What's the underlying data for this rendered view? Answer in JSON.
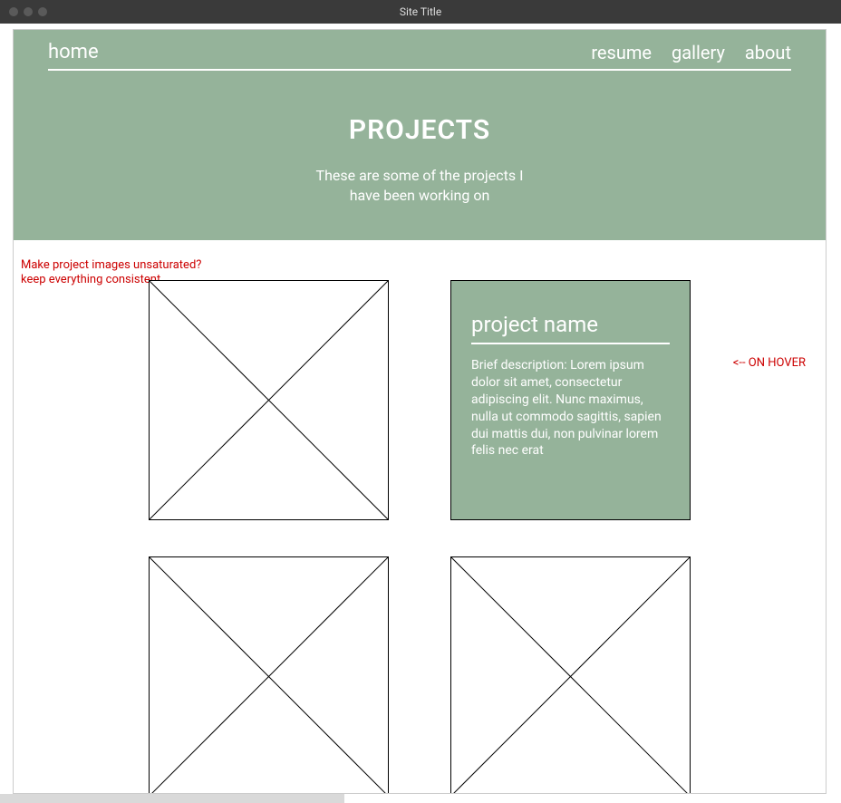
{
  "window": {
    "title": "Site Title"
  },
  "nav": {
    "home": "home",
    "resume": "resume",
    "gallery": "gallery",
    "about": "about"
  },
  "hero": {
    "title": "PROJECTS",
    "subtitle": "These are some of the projects I have been working on"
  },
  "annotations": {
    "left": "Make project images unsaturated? keep everything consistent",
    "right": "<-- ON HOVER"
  },
  "hover_card": {
    "title": "project name",
    "description": "Brief description: Lorem ipsum dolor sit amet, consectetur adipiscing elit. Nunc maximus, nulla ut commodo sagittis, sapien dui mattis dui, non pulvinar lorem felis nec erat"
  },
  "colors": {
    "accent": "#95b39a",
    "annotation": "#cc0000"
  }
}
